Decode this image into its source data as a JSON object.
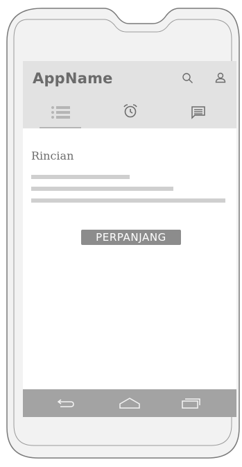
{
  "app_bar": {
    "title": "AppName",
    "actions": [
      {
        "icon": "search-icon"
      },
      {
        "icon": "user-icon"
      }
    ]
  },
  "tabs": [
    {
      "icon": "list-icon",
      "selected": true
    },
    {
      "icon": "alarm-clock-icon",
      "selected": false
    },
    {
      "icon": "message-icon",
      "selected": false
    }
  ],
  "content": {
    "title": "Rincian",
    "button_label": "PERPANJANG"
  },
  "nav_bar": {
    "buttons": [
      {
        "icon": "back-icon"
      },
      {
        "icon": "home-icon"
      },
      {
        "icon": "recent-apps-icon"
      }
    ]
  },
  "colors": {
    "app_bar_bg": "#e2e2e2",
    "nav_bar_bg": "#a3a3a3",
    "button_bg": "#8c8c8c",
    "placeholder_line": "#cfcfcf"
  }
}
